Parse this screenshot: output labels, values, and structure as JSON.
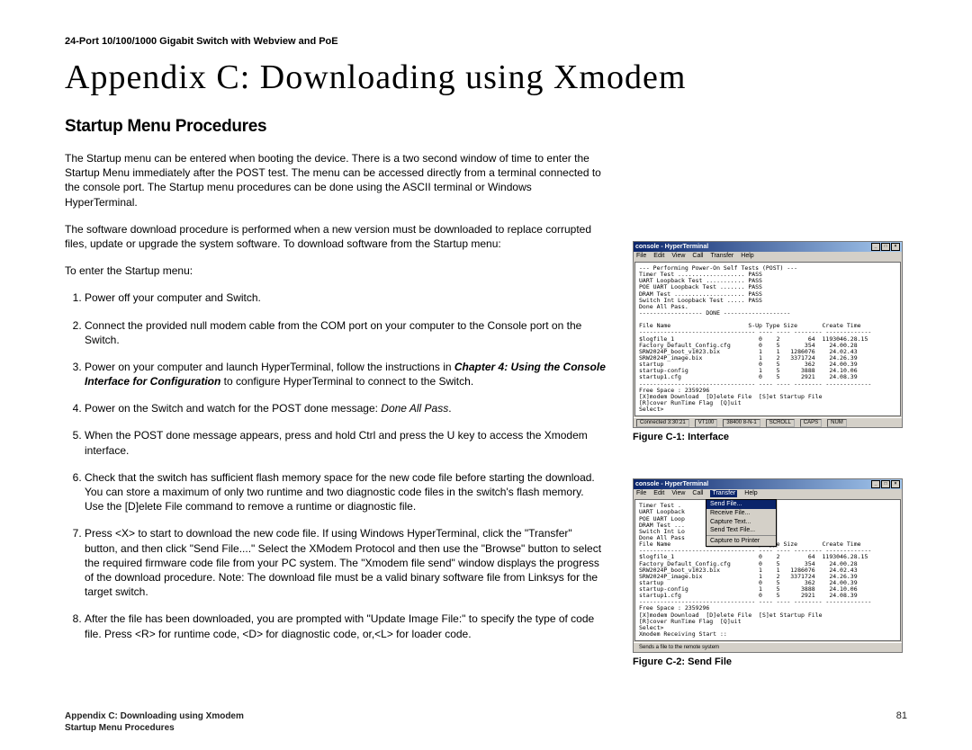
{
  "header": "24-Port 10/100/1000 Gigabit Switch with Webview and PoE",
  "title": "Appendix C: Downloading using Xmodem",
  "subheading": "Startup Menu Procedures",
  "para1": "The Startup menu can be entered when booting the device. There is a two second window of time to enter the Startup Menu immediately after the POST test. The menu can be accessed directly from a terminal connected to the console port. The Startup menu procedures can be done using the ASCII terminal or Windows HyperTerminal.",
  "para2": "The software download procedure is performed when a new version must be downloaded to replace corrupted files, update or upgrade the system software. To download software from the Startup menu:",
  "para3": "To enter the Startup menu:",
  "steps": {
    "s1": "Power off your computer and Switch.",
    "s2": "Connect the provided null modem cable from the COM port on your computer to the Console port on the Switch.",
    "s3a": "Power on your computer and launch HyperTerminal, follow the instructions in ",
    "s3b": "Chapter 4: Using the Console Interface for Configuration",
    "s3c": " to configure HyperTerminal to connect to the Switch.",
    "s4a": "Power on the Switch and watch for the POST done message: ",
    "s4b": "Done All Pass",
    "s4c": ".",
    "s5": "When the POST done message appears, press and hold Ctrl and press the U key to access the Xmodem interface.",
    "s6": "Check that the switch has sufficient flash memory space for the new code file before starting the download. You can store a maximum of only two runtime and two diagnostic code files in the switch's flash memory. Use the [D]elete File command to remove a runtime or diagnostic file.",
    "s7": "Press <X> to start to download the new code file. If using Windows HyperTerminal, click the \"Transfer\" button, and then click \"Send File....\" Select the XModem Protocol and then use the \"Browse\" button to select the required firmware code file from your PC system. The \"Xmodem file send\" window displays the progress of the download procedure. Note: The download file must be a valid binary software file from Linksys for the target switch.",
    "s8": "After the file has been downloaded, you are prompted with \"Update Image File:\" to specify the type of code file. Press <R> for runtime code, <D> for diagnostic code, or,<L> for loader code."
  },
  "fig1": {
    "caption": "Figure C-1: Interface",
    "windowTitle": "console - HyperTerminal",
    "menus": [
      "File",
      "Edit",
      "View",
      "Call",
      "Transfer",
      "Help"
    ],
    "terminal": "--- Performing Power-On Self Tests (POST) ---\nTimer Test ................... PASS\nUART Loopback Test ........... PASS\nPOE UART Loopback Test ....... PASS\nDRAM Test .................... PASS\nSwitch Int Loopback Test ..... PASS\nDone All Pass.\n------------------ DONE -------------------\n\nFile Name                      S-Up Type Size       Create Time\n--------------------------------- ---- ---- -------- -------------\n$logfile_1                        0    2        64  1193046.28.15\nFactory_Default_Config.cfg        0    5       354    24.00.28\nSRW2024P_boot_v1023.bix           1    1   1286076    24.02.43\nSRW2024P_image.bix                1    2   3371724    24.26.39\nstartup                           0    5       362    24.00.39\nstartup-config                    1    5      3888    24.10.06\nstartup1.cfg                      0    5      2921    24.08.39\n--------------------------------- ---- ---- -------- -------------\nFree Space : 2359296\n[X]modem Download  [D]elete File  [S]et Startup File\n[R]cover RunTime Flag  [Q]uit\nSelect>",
    "status": [
      "Connected 3:30:21",
      "VT100",
      "38400 8-N-1",
      "SCROLL",
      "CAPS",
      "NUM"
    ]
  },
  "fig2": {
    "caption": "Figure C-2: Send File",
    "windowTitle": "console - HyperTerminal",
    "menus": [
      "File",
      "Edit",
      "View",
      "Call",
      "Transfer",
      "Help"
    ],
    "dropdownHighlighted": "Send File...",
    "dropdownItems": [
      "Receive File...",
      "Capture Text...",
      "Send Text File...",
      "",
      "Capture to Printer"
    ],
    "terminalTop": "Timer Test .\nUART Loopback \nPOE UART Loop \nDRAM Test ...\nSwitch Int Lo \nDone All Pass",
    "terminalBottom": "\nFile Name                      S-Up Type Size       Create Time\n--------------------------------- ---- ---- -------- -------------\n$logfile_1                        0    2        64  1193046.28.15\nFactory_Default_Config.cfg        0    5       354    24.00.28\nSRW2024P_boot_v1023.bix           1    1   1286076    24.02.43\nSRW2024P_image.bix                1    2   3371724    24.26.39\nstartup                           0    5       362    24.00.39\nstartup-config                    1    5      3888    24.10.06\nstartup1.cfg                      0    5      2921    24.08.39\n--------------------------------- ---- ---- -------- -------------\nFree Space : 2359296\n[X]modem Download  [D]elete File  [S]et Startup File\n[R]cover RunTime Flag  [Q]uit\nSelect>\nXmodem Receiving Start ::",
    "status": "Sends a file to the remote system"
  },
  "footer": {
    "line1": "Appendix C: Downloading using Xmodem",
    "line2": "Startup Menu Procedures",
    "page": "81"
  }
}
